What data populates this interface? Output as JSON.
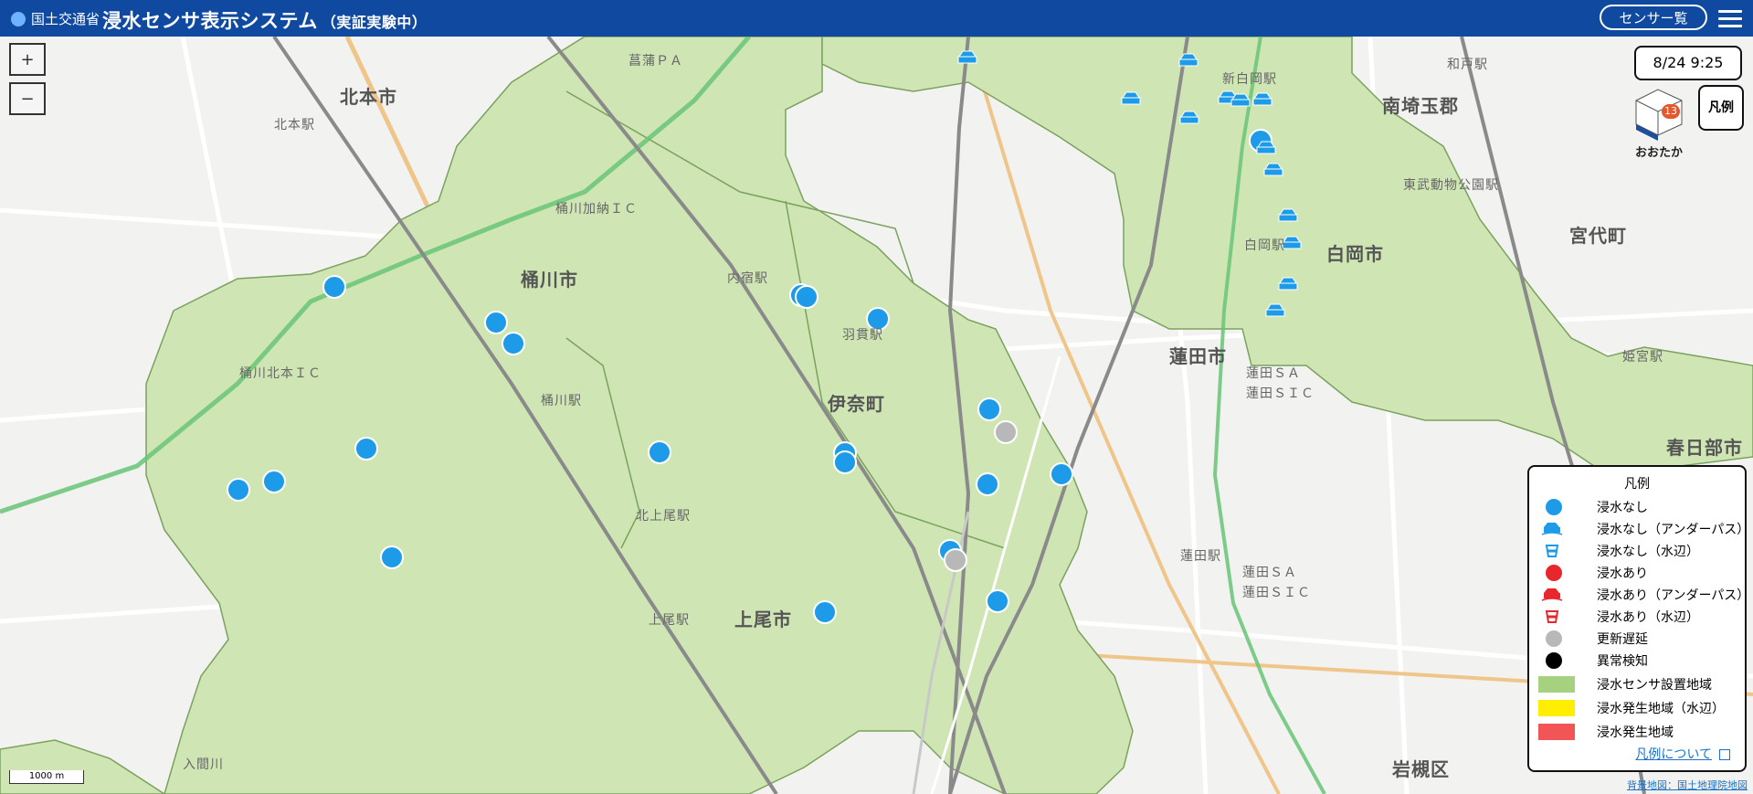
{
  "header": {
    "ministry": "国土交通省",
    "title": "浸水センサ表示システム",
    "subtitle": "（実証実験中）",
    "sensor_list_button": "センサー覧"
  },
  "controls": {
    "zoom_in": "+",
    "zoom_out": "−"
  },
  "timestamp": "8/24 9:25",
  "legend_button": "凡例",
  "city_badge": {
    "name": "おおたか",
    "count": "13"
  },
  "places": {
    "kitamoto": "北本市",
    "kitamoto_station": "北本駅",
    "okegawa": "桶川市",
    "okegawa_station": "桶川駅",
    "okegawa_kano_ic": "桶川加納ＩＣ",
    "okegawa_kitamoto_ic": "桶川北本ＩＣ",
    "ina": "伊奈町",
    "uchijuku": "内宿駅",
    "haraichi": "羽貫駅",
    "kitaageo": "北上尾駅",
    "ageo_station": "上尾駅",
    "ageo": "上尾市",
    "hasuda": "蓮田市",
    "hasuda_station": "蓮田駅",
    "shiraoka": "白岡市",
    "shiraoka_station": "白岡駅",
    "shinshiraoka": "新白岡駅",
    "minamisaitama": "南埼玉郡",
    "miyashiro": "宮代町",
    "tobu_zoo": "東武動物公園駅",
    "himemiya": "姫宮駅",
    "kasukabe": "春日部市",
    "iwatsuki": "岩槻区",
    "hasuda_sa": "蓮田ＳＡ",
    "hasuda_sic": "蓮田ＳＩＣ",
    "wadohara": "和戸駅",
    "kounosu_pa": "菖蒲ＰＡ",
    "irumagawa": "入間川"
  },
  "legend": {
    "title": "凡例",
    "items": [
      {
        "label": "浸水なし",
        "kind": "dot",
        "color": "#1e9be8"
      },
      {
        "label": "浸水なし（アンダーパス）",
        "kind": "car-icon",
        "color": "#1e9be8"
      },
      {
        "label": "浸水なし（水辺）",
        "kind": "bucket-icon",
        "color": "#1e9be8"
      },
      {
        "label": "浸水あり",
        "kind": "dot",
        "color": "#e8262b"
      },
      {
        "label": "浸水あり（アンダーパス）",
        "kind": "car-icon",
        "color": "#e8262b"
      },
      {
        "label": "浸水あり（水辺）",
        "kind": "bucket-icon",
        "color": "#e8262b"
      },
      {
        "label": "更新遅延",
        "kind": "dot",
        "color": "#b8b8b8"
      },
      {
        "label": "異常検知",
        "kind": "dot",
        "color": "#000000"
      },
      {
        "label": "浸水センサ設置地域",
        "kind": "rect",
        "color": "#a6d17e"
      },
      {
        "label": "浸水発生地域（水辺）",
        "kind": "rect",
        "color": "#ffee00"
      },
      {
        "label": "浸水発生地域",
        "kind": "rect",
        "color": "#f25555"
      }
    ],
    "link": "凡例について"
  },
  "scale": "1000 m",
  "attribution": "背景地図：国土地理院地図"
}
